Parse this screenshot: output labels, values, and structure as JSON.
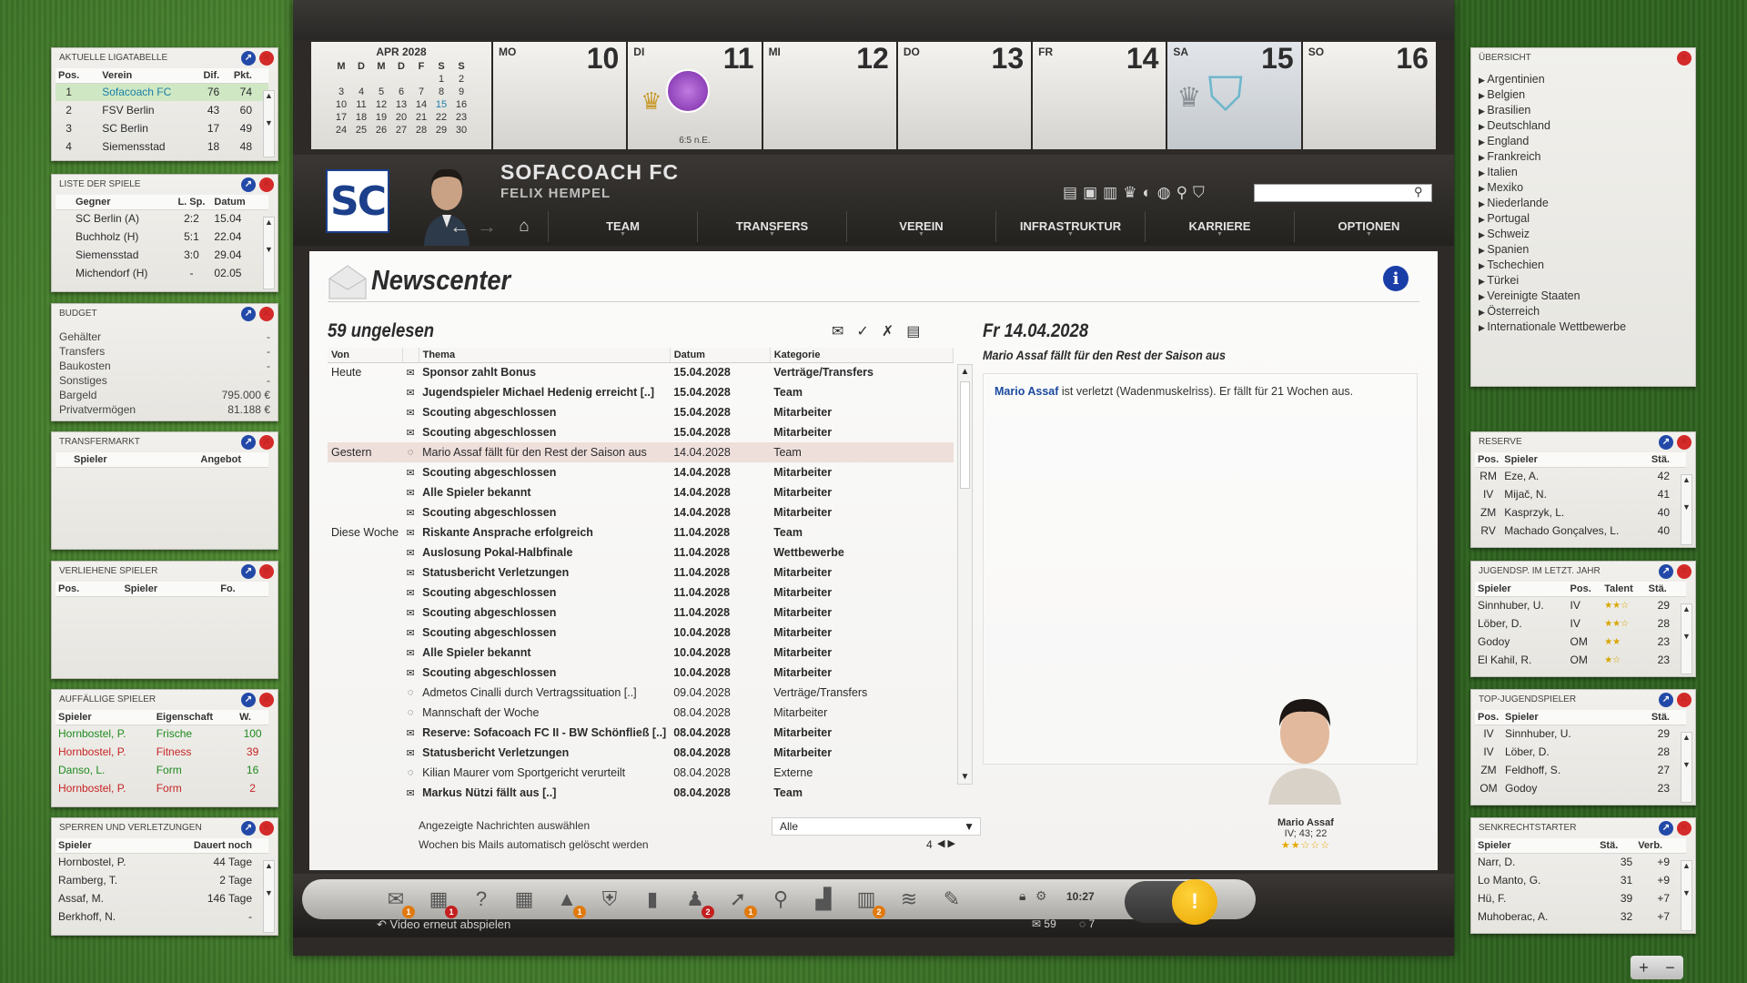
{
  "calendar": {
    "month": "APR 2028",
    "weekday_headers": [
      "M",
      "D",
      "M",
      "D",
      "F",
      "S",
      "S"
    ],
    "mini_days": [
      "",
      "",
      "",
      "",
      "",
      "1",
      "2",
      "3",
      "4",
      "5",
      "6",
      "7",
      "8",
      "9",
      "10",
      "11",
      "12",
      "13",
      "14",
      "15",
      "16",
      "17",
      "18",
      "19",
      "20",
      "21",
      "22",
      "23",
      "24",
      "25",
      "26",
      "27",
      "28",
      "29",
      "30"
    ],
    "days": [
      {
        "name": "MO",
        "num": "10",
        "result": ""
      },
      {
        "name": "DI",
        "num": "11",
        "result": "6:5 n.E."
      },
      {
        "name": "MI",
        "num": "12",
        "result": ""
      },
      {
        "name": "DO",
        "num": "13",
        "result": ""
      },
      {
        "name": "FR",
        "num": "14",
        "result": ""
      },
      {
        "name": "SA",
        "num": "15",
        "result": ""
      },
      {
        "name": "SO",
        "num": "16",
        "result": ""
      }
    ]
  },
  "club": {
    "crest": "SC",
    "name": "SOFACOACH FC",
    "manager": "FELIX HEMPEL"
  },
  "nav": {
    "items": [
      "TEAM",
      "TRANSFERS",
      "VEREIN",
      "INFRASTRUKTUR",
      "KARRIERE",
      "OPTIONEN"
    ]
  },
  "news": {
    "title": "Newscenter",
    "unread": "59 ungelesen",
    "columns": [
      "Von",
      "Thema",
      "Datum",
      "Kategorie"
    ],
    "messages": [
      {
        "group": "Heute",
        "subject": "Sponsor zahlt Bonus",
        "date": "15.04.2028",
        "category": "Verträge/Transfers",
        "unread": true,
        "type": "mail"
      },
      {
        "group": "",
        "subject": "Jugendspieler Michael Hedenig erreicht [..]",
        "date": "15.04.2028",
        "category": "Team",
        "unread": true,
        "type": "mail"
      },
      {
        "group": "",
        "subject": "Scouting abgeschlossen",
        "date": "15.04.2028",
        "category": "Mitarbeiter",
        "unread": true,
        "type": "mail"
      },
      {
        "group": "",
        "subject": "Scouting abgeschlossen",
        "date": "15.04.2028",
        "category": "Mitarbeiter",
        "unread": true,
        "type": "mail"
      },
      {
        "group": "Gestern",
        "subject": "Mario Assaf fällt für den Rest der Saison aus",
        "date": "14.04.2028",
        "category": "Team",
        "unread": false,
        "type": "chat",
        "selected": true
      },
      {
        "group": "",
        "subject": "Scouting abgeschlossen",
        "date": "14.04.2028",
        "category": "Mitarbeiter",
        "unread": true,
        "type": "mail"
      },
      {
        "group": "",
        "subject": "Alle Spieler bekannt",
        "date": "14.04.2028",
        "category": "Mitarbeiter",
        "unread": true,
        "type": "mail"
      },
      {
        "group": "",
        "subject": "Scouting abgeschlossen",
        "date": "14.04.2028",
        "category": "Mitarbeiter",
        "unread": true,
        "type": "mail"
      },
      {
        "group": "Diese Woche",
        "subject": "Riskante Ansprache erfolgreich",
        "date": "11.04.2028",
        "category": "Team",
        "unread": true,
        "type": "mail"
      },
      {
        "group": "",
        "subject": "Auslosung Pokal-Halbfinale",
        "date": "11.04.2028",
        "category": "Wettbewerbe",
        "unread": true,
        "type": "mail"
      },
      {
        "group": "",
        "subject": "Statusbericht Verletzungen",
        "date": "11.04.2028",
        "category": "Mitarbeiter",
        "unread": true,
        "type": "mail"
      },
      {
        "group": "",
        "subject": "Scouting abgeschlossen",
        "date": "11.04.2028",
        "category": "Mitarbeiter",
        "unread": true,
        "type": "mail"
      },
      {
        "group": "",
        "subject": "Scouting abgeschlossen",
        "date": "11.04.2028",
        "category": "Mitarbeiter",
        "unread": true,
        "type": "mail"
      },
      {
        "group": "",
        "subject": "Scouting abgeschlossen",
        "date": "10.04.2028",
        "category": "Mitarbeiter",
        "unread": true,
        "type": "mail"
      },
      {
        "group": "",
        "subject": "Alle Spieler bekannt",
        "date": "10.04.2028",
        "category": "Mitarbeiter",
        "unread": true,
        "type": "mail"
      },
      {
        "group": "",
        "subject": "Scouting abgeschlossen",
        "date": "10.04.2028",
        "category": "Mitarbeiter",
        "unread": true,
        "type": "mail"
      },
      {
        "group": "",
        "subject": "Admetos Cinalli durch Vertragssituation [..]",
        "date": "09.04.2028",
        "category": "Verträge/Transfers",
        "unread": false,
        "type": "chat"
      },
      {
        "group": "",
        "subject": "Mannschaft der Woche",
        "date": "08.04.2028",
        "category": "Mitarbeiter",
        "unread": false,
        "type": "chat"
      },
      {
        "group": "",
        "subject": "Reserve: Sofacoach FC II - BW Schönfließ [..]",
        "date": "08.04.2028",
        "category": "Mitarbeiter",
        "unread": true,
        "type": "mail"
      },
      {
        "group": "",
        "subject": "Statusbericht Verletzungen",
        "date": "08.04.2028",
        "category": "Mitarbeiter",
        "unread": true,
        "type": "mail"
      },
      {
        "group": "",
        "subject": "Kilian Maurer vom Sportgericht verurteilt",
        "date": "08.04.2028",
        "category": "Externe",
        "unread": false,
        "type": "chat"
      },
      {
        "group": "",
        "subject": "Markus Nützi fällt aus [..]",
        "date": "08.04.2028",
        "category": "Team",
        "unread": true,
        "type": "mail"
      }
    ],
    "filter_label": "Angezeigte Nachrichten auswählen",
    "filter_value": "Alle",
    "weeks_label": "Wochen bis Mails automatisch gelöscht werden",
    "weeks_value": "4"
  },
  "detail": {
    "date": "Fr 14.04.2028",
    "subject": "Mario Assaf fällt für den Rest der Saison aus",
    "link_name": "Mario Assaf",
    "body": " ist verletzt (Wadenmuskelriss). Er fällt für 21 Wochen aus.",
    "player_name": "Mario Assaf",
    "player_info": "IV; 43; 22",
    "player_stars": "★★☆☆☆"
  },
  "bottom": {
    "clock": "10:27",
    "replay": "Video erneut abspielen",
    "mail_count": "59",
    "chat_count": "7",
    "dock_icons": [
      {
        "name": "mail-icon",
        "glyph": "✉",
        "badge": "1",
        "badge_color": "o"
      },
      {
        "name": "money-icon",
        "glyph": "▦",
        "badge": "1",
        "badge_color": "r"
      },
      {
        "name": "money-question-icon",
        "glyph": "?",
        "badge": "",
        "badge_color": ""
      },
      {
        "name": "money-stack-icon",
        "glyph": "▦",
        "badge": "",
        "badge_color": ""
      },
      {
        "name": "cone-icon",
        "glyph": "▲",
        "badge": "1",
        "badge_color": "o"
      },
      {
        "name": "badge-icon",
        "glyph": "⛨",
        "badge": "",
        "badge_color": ""
      },
      {
        "name": "door-icon",
        "glyph": "▮",
        "badge": "",
        "badge_color": ""
      },
      {
        "name": "players-icon",
        "glyph": "♟",
        "badge": "2",
        "badge_color": "r"
      },
      {
        "name": "arrow-icon",
        "glyph": "➚",
        "badge": "1",
        "badge_color": "o"
      },
      {
        "name": "magnifier-icon",
        "glyph": "⚲",
        "badge": "",
        "badge_color": ""
      },
      {
        "name": "chart-icon",
        "glyph": "▟",
        "badge": "",
        "badge_color": ""
      },
      {
        "name": "files-icon",
        "glyph": "▥",
        "badge": "2",
        "badge_color": "o"
      },
      {
        "name": "scarf-icon",
        "glyph": "≋",
        "badge": "",
        "badge_color": ""
      },
      {
        "name": "tools-icon",
        "glyph": "✎",
        "badge": "",
        "badge_color": ""
      }
    ]
  },
  "widgets": {
    "league": {
      "title": "AKTUELLE LIGATABELLE",
      "cols": [
        "Pos.",
        "Verein",
        "Dif.",
        "Pkt."
      ],
      "rows": [
        {
          "pos": "1",
          "team": "Sofacoach FC",
          "dif": "76",
          "pts": "74"
        },
        {
          "pos": "2",
          "team": "FSV Berlin",
          "dif": "43",
          "pts": "60"
        },
        {
          "pos": "3",
          "team": "SC Berlin",
          "dif": "17",
          "pts": "49"
        },
        {
          "pos": "4",
          "team": "Siemensstad",
          "dif": "18",
          "pts": "48"
        }
      ]
    },
    "games": {
      "title": "LISTE DER SPIELE",
      "cols": [
        "Gegner",
        "L. Sp.",
        "Datum"
      ],
      "rows": [
        {
          "opp": "SC Berlin (A)",
          "last": "2:2",
          "date": "15.04"
        },
        {
          "opp": "Buchholz (H)",
          "last": "5:1",
          "date": "22.04"
        },
        {
          "opp": "Siemensstad",
          "last": "3:0",
          "date": "29.04"
        },
        {
          "opp": "Michendorf (H)",
          "last": "-",
          "date": "02.05"
        }
      ]
    },
    "budget": {
      "title": "BUDGET",
      "rows": [
        {
          "label": "Gehälter",
          "value": "-"
        },
        {
          "label": "Transfers",
          "value": "-"
        },
        {
          "label": "Baukosten",
          "value": "-"
        },
        {
          "label": "Sonstiges",
          "value": "-"
        },
        {
          "label": "Bargeld",
          "value": "795.000 €"
        },
        {
          "label": "Privatvermögen",
          "value": "81.188 €"
        }
      ]
    },
    "transfer": {
      "title": "TRANSFERMARKT",
      "cols": [
        "Spieler",
        "Angebot"
      ]
    },
    "loaned": {
      "title": "VERLIEHENE SPIELER",
      "cols": [
        "Pos.",
        "Spieler",
        "Fo."
      ]
    },
    "notable": {
      "title": "AUFFÄLLIGE SPIELER",
      "cols": [
        "Spieler",
        "Eigenschaft",
        "W."
      ],
      "rows": [
        {
          "player": "Hornbostel, P.",
          "prop": "Frische",
          "val": "100",
          "color": "green"
        },
        {
          "player": "Hornbostel, P.",
          "prop": "Fitness",
          "val": "39",
          "color": "red"
        },
        {
          "player": "Danso, L.",
          "prop": "Form",
          "val": "16",
          "color": "green"
        },
        {
          "player": "Hornbostel, P.",
          "prop": "Form",
          "val": "2",
          "color": "red"
        }
      ]
    },
    "injuries": {
      "title": "SPERREN UND VERLETZUNGEN",
      "cols": [
        "Spieler",
        "Dauert noch"
      ],
      "rows": [
        {
          "player": "Hornbostel, P.",
          "dur": "44 Tage"
        },
        {
          "player": "Ramberg, T.",
          "dur": "2 Tage"
        },
        {
          "player": "Assaf, M.",
          "dur": "146 Tage"
        },
        {
          "player": "Berkhoff, N.",
          "dur": "-"
        }
      ]
    },
    "overview": {
      "title": "ÜBERSICHT",
      "items": [
        "Argentinien",
        "Belgien",
        "Brasilien",
        "Deutschland",
        "England",
        "Frankreich",
        "Italien",
        "Mexiko",
        "Niederlande",
        "Portugal",
        "Schweiz",
        "Spanien",
        "Tschechien",
        "Türkei",
        "Vereinigte Staaten",
        "Österreich",
        "Internationale Wettbewerbe"
      ]
    },
    "reserve": {
      "title": "RESERVE",
      "cols": [
        "Pos.",
        "Spieler",
        "Stä."
      ],
      "rows": [
        {
          "pos": "RM",
          "player": "Eze, A.",
          "str": "42"
        },
        {
          "pos": "IV",
          "player": "Mijač, N.",
          "str": "41"
        },
        {
          "pos": "ZM",
          "player": "Kasprzyk, L.",
          "str": "40"
        },
        {
          "pos": "RV",
          "player": "Machado Gonçalves, L.",
          "str": "40"
        }
      ]
    },
    "youth": {
      "title": "JUGENDSP. IM LETZT. JAHR",
      "cols": [
        "Spieler",
        "Pos.",
        "Talent",
        "Stä."
      ],
      "rows": [
        {
          "player": "Sinnhuber, U.",
          "pos": "IV",
          "talent": "★★☆",
          "str": "29"
        },
        {
          "player": "Löber, D.",
          "pos": "IV",
          "talent": "★★☆",
          "str": "28"
        },
        {
          "player": "Godoy",
          "pos": "OM",
          "talent": "★★",
          "str": "23"
        },
        {
          "player": "El Kahil, R.",
          "pos": "OM",
          "talent": "★☆",
          "str": "23"
        }
      ]
    },
    "topyouth": {
      "title": "TOP-JUGENDSPIELER",
      "cols": [
        "Pos.",
        "Spieler",
        "Stä."
      ],
      "rows": [
        {
          "pos": "IV",
          "player": "Sinnhuber, U.",
          "str": "29"
        },
        {
          "pos": "IV",
          "player": "Löber, D.",
          "str": "28"
        },
        {
          "pos": "ZM",
          "player": "Feldhoff, S.",
          "str": "27"
        },
        {
          "pos": "OM",
          "player": "Godoy",
          "str": "23"
        }
      ]
    },
    "risers": {
      "title": "SENKRECHTSTARTER",
      "cols": [
        "Spieler",
        "Stä.",
        "Verb."
      ],
      "rows": [
        {
          "player": "Narr, D.",
          "str": "35",
          "imp": "+9"
        },
        {
          "player": "Lo Manto, G.",
          "str": "31",
          "imp": "+9"
        },
        {
          "player": "Hü, F.",
          "str": "39",
          "imp": "+7"
        },
        {
          "player": "Muhoberac, A.",
          "str": "32",
          "imp": "+7"
        }
      ]
    }
  },
  "colors": {
    "accent_blue": "#1a3ea8",
    "close_red": "#d42a2a",
    "highlight_green": "#cfe8c3",
    "alert_yellow": "#f0b400"
  }
}
